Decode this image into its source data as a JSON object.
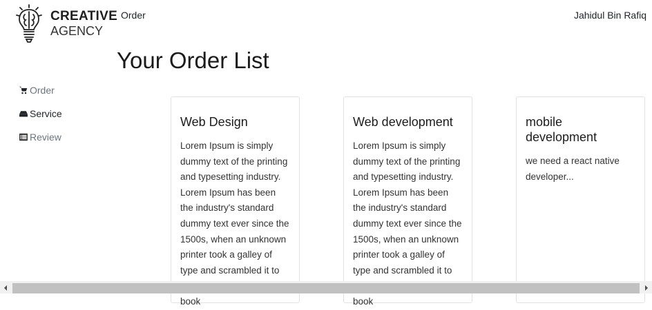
{
  "brand": {
    "line1": "CREATIVE",
    "line2": "AGENCY",
    "icon": "lightbulb-brain-icon"
  },
  "header": {
    "nav_order": "Order",
    "user_name": "Jahidul Bin Rafiq"
  },
  "page": {
    "title": "Your Order List"
  },
  "sidebar": {
    "items": [
      {
        "label": "Order",
        "icon": "cart-icon"
      },
      {
        "label": "Service",
        "icon": "hdd-icon"
      },
      {
        "label": "Review",
        "icon": "list-alt-icon"
      }
    ]
  },
  "orders": [
    {
      "title": "Web Design",
      "description": "Lorem Ipsum is simply dummy text of the printing and typesetting industry. Lorem Ipsum has been the industry's standard dummy text ever since the 1500s, when an unknown printer took a galley of type and scrambled it to make a type specimen book"
    },
    {
      "title": "Web development",
      "description": "Lorem Ipsum is simply dummy text of the printing and typesetting industry. Lorem Ipsum has been the industry's standard dummy text ever since the 1500s, when an unknown printer took a galley of type and scrambled it to make a type specimen book"
    },
    {
      "title": "mobile development",
      "description": "we need a react native developer..."
    }
  ],
  "colors": {
    "text": "#212529",
    "muted": "#6c757d",
    "card_border": "#e2e2e2",
    "scrollbar_thumb": "#c1c1c1",
    "scrollbar_track": "#f1f1f1"
  }
}
